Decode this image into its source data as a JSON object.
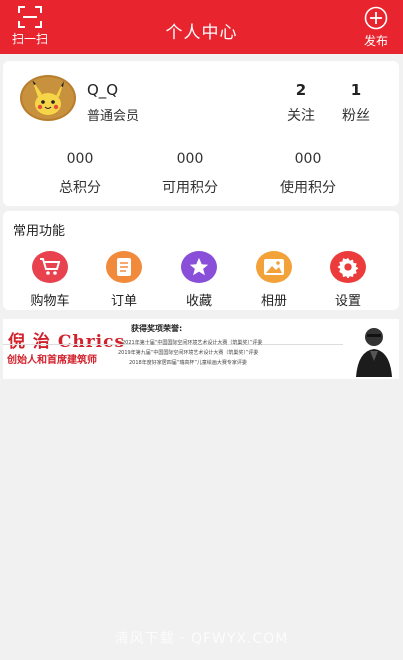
{
  "header": {
    "title": "个人中心",
    "scan_label": "扫一扫",
    "publish_label": "发布",
    "bg_color": "#e8242f"
  },
  "profile": {
    "username": "Q_Q",
    "level": "普通会员",
    "following_count": "2",
    "following_label": "关注",
    "fans_count": "1",
    "fans_label": "粉丝",
    "points": [
      {
        "value": "000",
        "label": "总积分"
      },
      {
        "value": "000",
        "label": "可用积分"
      },
      {
        "value": "000",
        "label": "使用积分"
      }
    ]
  },
  "functions": {
    "title": "常用功能",
    "items": [
      {
        "label": "购物车",
        "icon": "cart-icon",
        "color": "#e8424f"
      },
      {
        "label": "订单",
        "icon": "order-icon",
        "color": "#f28a3c"
      },
      {
        "label": "收藏",
        "icon": "star-icon",
        "color": "#8a4fd8"
      },
      {
        "label": "相册",
        "icon": "album-icon",
        "color": "#f3a23a"
      },
      {
        "label": "设置",
        "icon": "gear-icon",
        "color": "#ec3b3b"
      }
    ]
  },
  "banner": {
    "name": "倪 治 Chrics",
    "role": "创始人和首席建筑师",
    "awards_title": "获得奖项荣誉:",
    "awards": [
      "2021年第十届“中国国际空间环境艺术设计大赛（筑巢奖）”评委",
      "2019年第九届“中国国际空间环境艺术设计大赛（筑巢奖）”评委",
      "2018年度好家居四届“瑞高杯”儿童绘画大赛专家评委"
    ]
  },
  "watermark": "清风下载 · QFWYX.COM"
}
